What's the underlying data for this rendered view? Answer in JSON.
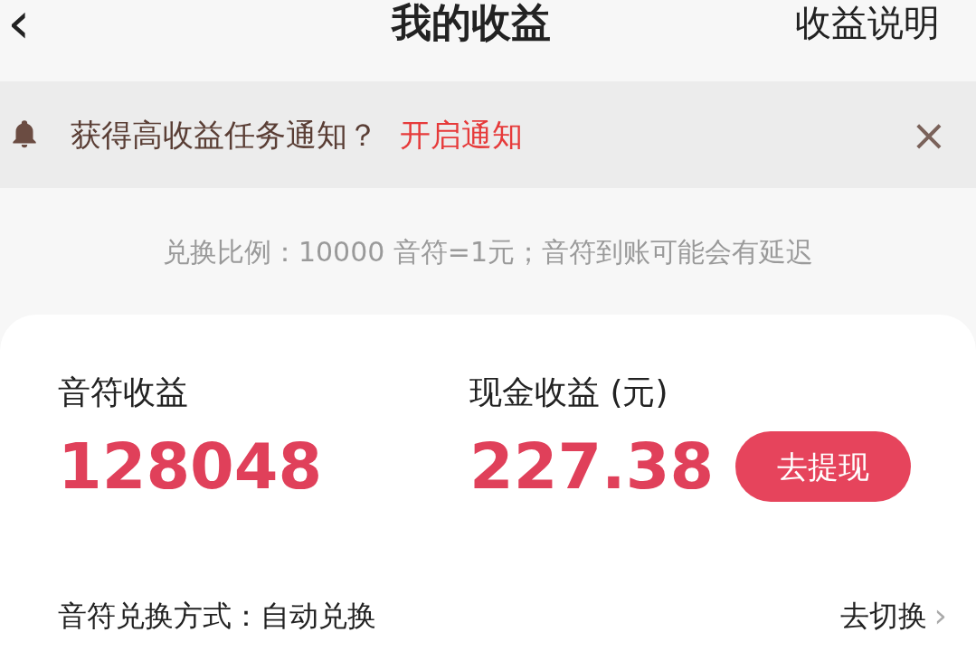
{
  "header": {
    "back": "‹",
    "title": "我的收益",
    "action": "收益说明"
  },
  "banner": {
    "text": "获得高收益任务通知？",
    "link": "开启通知",
    "close": "×"
  },
  "rate_note": "兑换比例：10000 音符=1元；音符到账可能会有延迟",
  "earnings": [
    {
      "label": "音符收益",
      "value": "128048"
    },
    {
      "label": "现金收益 (元)",
      "value": "227.38",
      "button": "去提现"
    }
  ],
  "exchange": {
    "label": "音符兑换方式：自动兑换",
    "action": "去切换",
    "chevron": "›"
  }
}
